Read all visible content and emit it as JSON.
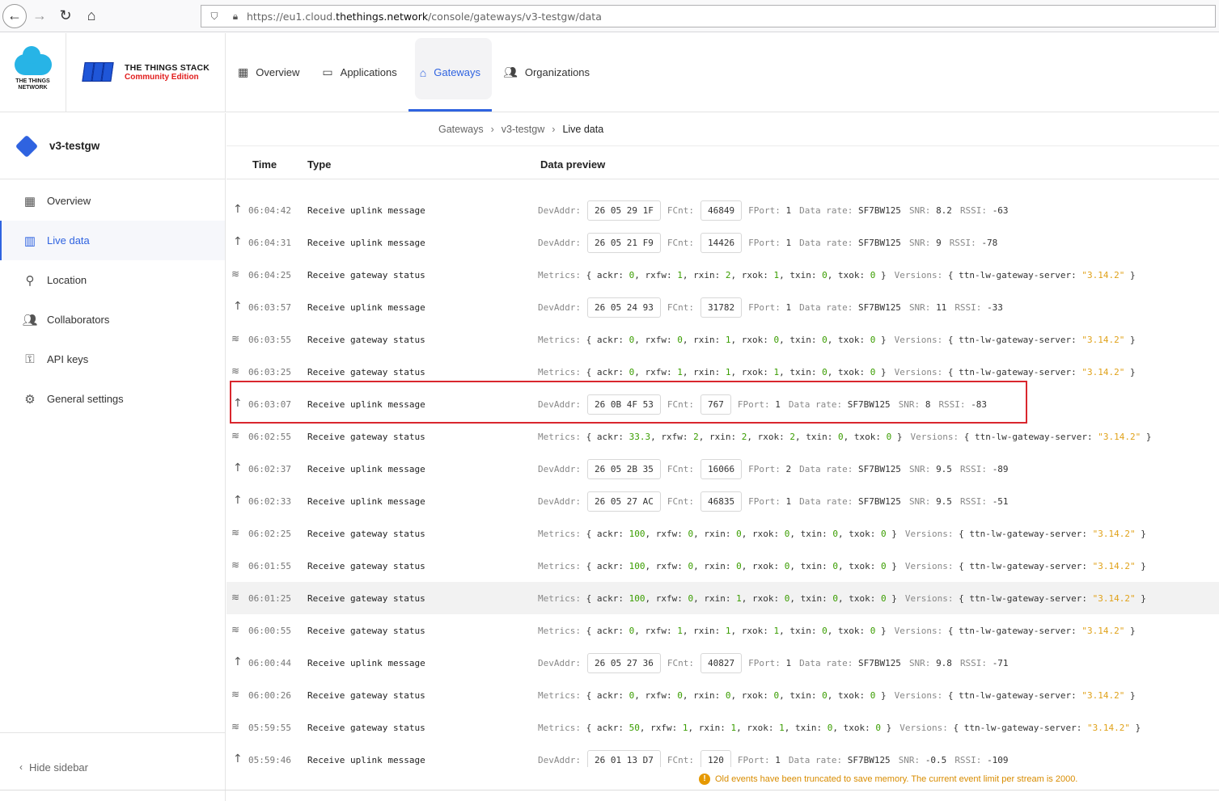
{
  "browser": {
    "url_prefix": "https://eu1.cloud.",
    "url_domain": "thethings.network",
    "url_path": "/console/gateways/v3-testgw/data"
  },
  "brand": {
    "ttn_line1": "THE THINGS",
    "ttn_line2": "NETWORK",
    "tts_title": "THE THINGS STACK",
    "tts_edition": "Community Edition"
  },
  "main_nav": [
    {
      "label": "Overview",
      "icon": "grid-icon"
    },
    {
      "label": "Applications",
      "icon": "window-icon"
    },
    {
      "label": "Gateways",
      "icon": "gateway-icon"
    },
    {
      "label": "Organizations",
      "icon": "people-icon"
    }
  ],
  "sidebar": {
    "gateway_name": "v3-testgw",
    "items": [
      {
        "label": "Overview",
        "icon": "grid-icon"
      },
      {
        "label": "Live data",
        "icon": "bar-chart-icon"
      },
      {
        "label": "Location",
        "icon": "pin-icon"
      },
      {
        "label": "Collaborators",
        "icon": "people-icon"
      },
      {
        "label": "API keys",
        "icon": "key-icon"
      },
      {
        "label": "General settings",
        "icon": "gear-icon"
      }
    ],
    "hide_label": "Hide sidebar"
  },
  "breadcrumb": [
    "Gateways",
    "v3-testgw",
    "Live data"
  ],
  "table": {
    "headers": {
      "time": "Time",
      "type": "Type",
      "preview": "Data preview"
    }
  },
  "labels": {
    "devaddr": "DevAddr:",
    "fcnt": "FCnt:",
    "fport": "FPort:",
    "datarate": "Data rate:",
    "snr": "SNR:",
    "rssi": "RSSI:",
    "metrics": "Metrics:",
    "versions": "Versions:",
    "server_key": "ttn-lw-gateway-server",
    "uplink_type": "Receive uplink message",
    "status_type": "Receive gateway status"
  },
  "events": [
    {
      "kind": "uplink",
      "time": "06:04:42",
      "devaddr": "26 05 29 1F",
      "fcnt": "46849",
      "fport": "1",
      "datarate": "SF7BW125",
      "snr": "8.2",
      "rssi": "-63"
    },
    {
      "kind": "uplink",
      "time": "06:04:31",
      "devaddr": "26 05 21 F9",
      "fcnt": "14426",
      "fport": "1",
      "datarate": "SF7BW125",
      "snr": "9",
      "rssi": "-78"
    },
    {
      "kind": "status",
      "time": "06:04:25",
      "ackr": "0",
      "rxfw": "1",
      "rxin": "2",
      "rxok": "1",
      "txin": "0",
      "txok": "0",
      "version": "\"3.14.2\""
    },
    {
      "kind": "uplink",
      "time": "06:03:57",
      "devaddr": "26 05 24 93",
      "fcnt": "31782",
      "fport": "1",
      "datarate": "SF7BW125",
      "snr": "11",
      "rssi": "-33"
    },
    {
      "kind": "status",
      "time": "06:03:55",
      "ackr": "0",
      "rxfw": "0",
      "rxin": "1",
      "rxok": "0",
      "txin": "0",
      "txok": "0",
      "version": "\"3.14.2\""
    },
    {
      "kind": "status",
      "time": "06:03:25",
      "ackr": "0",
      "rxfw": "1",
      "rxin": "1",
      "rxok": "1",
      "txin": "0",
      "txok": "0",
      "version": "\"3.14.2\""
    },
    {
      "kind": "uplink",
      "time": "06:03:07",
      "devaddr": "26 0B 4F 53",
      "fcnt": "767",
      "fport": "1",
      "datarate": "SF7BW125",
      "snr": "8",
      "rssi": "-83"
    },
    {
      "kind": "status",
      "time": "06:02:55",
      "ackr": "33.3",
      "rxfw": "2",
      "rxin": "2",
      "rxok": "2",
      "txin": "0",
      "txok": "0",
      "version": "\"3.14.2\""
    },
    {
      "kind": "uplink",
      "time": "06:02:37",
      "devaddr": "26 05 2B 35",
      "fcnt": "16066",
      "fport": "2",
      "datarate": "SF7BW125",
      "snr": "9.5",
      "rssi": "-89"
    },
    {
      "kind": "uplink",
      "time": "06:02:33",
      "devaddr": "26 05 27 AC",
      "fcnt": "46835",
      "fport": "1",
      "datarate": "SF7BW125",
      "snr": "9.5",
      "rssi": "-51"
    },
    {
      "kind": "status",
      "time": "06:02:25",
      "ackr": "100",
      "rxfw": "0",
      "rxin": "0",
      "rxok": "0",
      "txin": "0",
      "txok": "0",
      "version": "\"3.14.2\""
    },
    {
      "kind": "status",
      "time": "06:01:55",
      "ackr": "100",
      "rxfw": "0",
      "rxin": "0",
      "rxok": "0",
      "txin": "0",
      "txok": "0",
      "version": "\"3.14.2\""
    },
    {
      "kind": "status",
      "time": "06:01:25",
      "ackr": "100",
      "rxfw": "0",
      "rxin": "1",
      "rxok": "0",
      "txin": "0",
      "txok": "0",
      "version": "\"3.14.2\""
    },
    {
      "kind": "status",
      "time": "06:00:55",
      "ackr": "0",
      "rxfw": "1",
      "rxin": "1",
      "rxok": "1",
      "txin": "0",
      "txok": "0",
      "version": "\"3.14.2\""
    },
    {
      "kind": "uplink",
      "time": "06:00:44",
      "devaddr": "26 05 27 36",
      "fcnt": "40827",
      "fport": "1",
      "datarate": "SF7BW125",
      "snr": "9.8",
      "rssi": "-71"
    },
    {
      "kind": "status",
      "time": "06:00:26",
      "ackr": "0",
      "rxfw": "0",
      "rxin": "0",
      "rxok": "0",
      "txin": "0",
      "txok": "0",
      "version": "\"3.14.2\""
    },
    {
      "kind": "status",
      "time": "05:59:55",
      "ackr": "50",
      "rxfw": "1",
      "rxin": "1",
      "rxok": "1",
      "txin": "0",
      "txok": "0",
      "version": "\"3.14.2\""
    },
    {
      "kind": "uplink",
      "time": "05:59:46",
      "devaddr": "26 01 13 D7",
      "fcnt": "120",
      "fport": "1",
      "datarate": "SF7BW125",
      "snr": "-0.5",
      "rssi": "-109"
    }
  ],
  "notice": "Old events have been truncated to save memory. The current event limit per stream is 2000.",
  "colors": {
    "accent": "#2f63e0",
    "highlight": "#d9272e",
    "number": "#3a9d00",
    "string": "#e0a21a",
    "notice": "#d88c00"
  }
}
